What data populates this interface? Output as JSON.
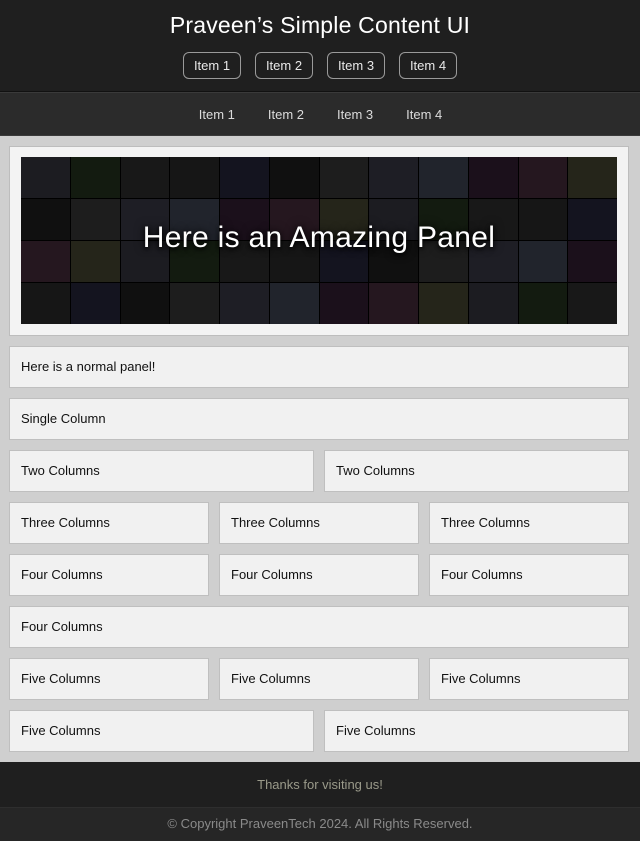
{
  "header": {
    "title": "Praveen’s Simple Content UI",
    "pill_nav": [
      "Item 1",
      "Item 2",
      "Item 3",
      "Item 4"
    ]
  },
  "subnav": [
    "Item 1",
    "Item 2",
    "Item 3",
    "Item 4"
  ],
  "hero": {
    "title": "Here is an Amazing Panel",
    "tile_colors": [
      "#2c2c34",
      "#1a1a1a",
      "#3a2430",
      "#222",
      "#333844",
      "#1e2a1a",
      "#2d2d2d",
      "#3a3a28",
      "#202030",
      "#2a1a2a",
      "#262626",
      "#2e2e3a"
    ]
  },
  "rows": [
    [
      "Here is a normal panel!"
    ],
    [
      "Single Column"
    ],
    [
      "Two Columns",
      "Two Columns"
    ],
    [
      "Three Columns",
      "Three Columns",
      "Three Columns"
    ],
    [
      "Four Columns",
      "Four Columns",
      "Four Columns"
    ],
    [
      "Four Columns"
    ],
    [
      "Five Columns",
      "Five Columns",
      "Five Columns"
    ],
    [
      "Five Columns",
      "Five Columns"
    ]
  ],
  "footer": {
    "thanks": "Thanks for visiting us!",
    "copyright": "© Copyright PraveenTech 2024. All Rights Reserved."
  }
}
